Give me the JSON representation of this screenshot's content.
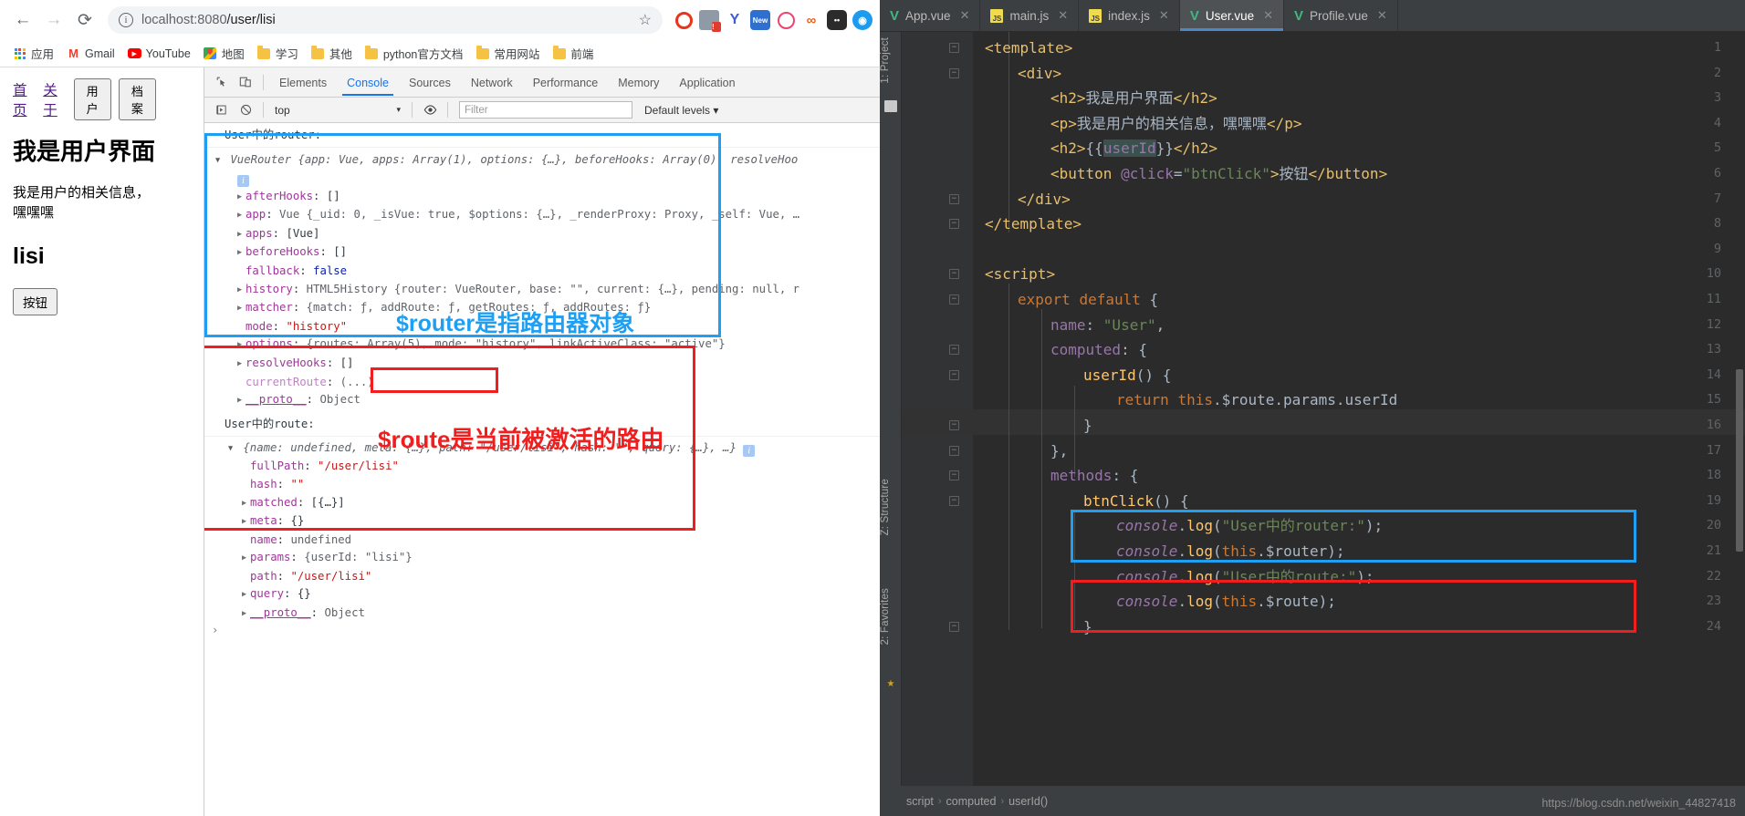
{
  "browser": {
    "nav": {
      "back": "←",
      "forward": "→",
      "reload": "⟳"
    },
    "omnibox": {
      "info_icon": "ⓘ",
      "url_host": "localhost:8080",
      "url_path": "/user/lisi",
      "url_full": "localhost:8080/user/lisi",
      "star_icon": "☆"
    },
    "extensions": [
      "ublock-origin-icon",
      "extension-warning-icon",
      "yandex-icon",
      "new-tab-icon",
      "clock-icon",
      "infinity-icon",
      "panda-icon",
      "location-icon"
    ],
    "bookmarks": [
      {
        "label": "应用",
        "icon": "apps-grid-icon"
      },
      {
        "label": "Gmail",
        "icon": "gmail-icon"
      },
      {
        "label": "YouTube",
        "icon": "youtube-icon"
      },
      {
        "label": "地图",
        "icon": "maps-icon"
      },
      {
        "label": "学习",
        "icon": "folder-icon"
      },
      {
        "label": "其他",
        "icon": "folder-icon"
      },
      {
        "label": "python官方文档",
        "icon": "folder-icon"
      },
      {
        "label": "常用网站",
        "icon": "folder-icon"
      },
      {
        "label": "前端",
        "icon": "folder-icon"
      }
    ]
  },
  "page": {
    "nav_links": [
      "首页",
      "关于"
    ],
    "nav_buttons": [
      "用户",
      "档案"
    ],
    "heading": "我是用户界面",
    "paragraph": "我是用户的相关信息，嘿嘿嘿",
    "user_id": "lisi",
    "button_label": "按钮"
  },
  "devtools": {
    "toolbar_icons": [
      "inspect-element-icon",
      "device-toolbar-icon"
    ],
    "tabs": [
      "Elements",
      "Console",
      "Sources",
      "Network",
      "Performance",
      "Memory",
      "Application"
    ],
    "active_tab": "Console",
    "filterbar": {
      "execute_icon": "execute-snippet-icon",
      "clear_icon": "clear-console-icon",
      "context": "top",
      "eye_icon": "live-expression-icon",
      "filter_placeholder": "Filter",
      "levels": "Default levels",
      "levels_caret": "▾"
    },
    "console": {
      "log1_label": "User中的router:",
      "router_header": "VueRouter {app: Vue, apps: Array(1), options: {…}, beforeHooks: Array(0), resolveHoo",
      "router_props": [
        {
          "key": "afterHooks",
          "value": "[]",
          "expandable": true
        },
        {
          "key": "app",
          "value": "Vue {_uid: 0, _isVue: true, $options: {…}, _renderProxy: Proxy, _self: Vue, …",
          "expandable": true
        },
        {
          "key": "apps",
          "value": "[Vue]",
          "expandable": true
        },
        {
          "key": "beforeHooks",
          "value": "[]",
          "expandable": true
        },
        {
          "key": "fallback",
          "value": "false",
          "expandable": false
        },
        {
          "key": "history",
          "value": "HTML5History {router: VueRouter, base: \"\", current: {…}, pending: null, r",
          "expandable": true
        },
        {
          "key": "matcher",
          "value": "{match: ƒ, addRoute: ƒ, getRoutes: ƒ, addRoutes: ƒ}",
          "expandable": true
        },
        {
          "key": "mode",
          "value": "\"history\"",
          "expandable": false
        },
        {
          "key": "options",
          "value": "{routes: Array(5), mode: \"history\", linkActiveClass: \"active\"}",
          "expandable": true
        },
        {
          "key": "resolveHooks",
          "value": "[]",
          "expandable": true
        },
        {
          "key": "currentRoute",
          "value": "(...)",
          "expandable": false
        },
        {
          "key": "__proto__",
          "value": "Object",
          "expandable": true
        }
      ],
      "log2_label": "User中的route:",
      "route_header": "{name: undefined, meta: {…}, path: \"/user/lisi\", hash: \"\", query: {…}, …}",
      "route_props": [
        {
          "key": "fullPath",
          "value": "\"/user/lisi\"",
          "expandable": false
        },
        {
          "key": "hash",
          "value": "\"\"",
          "expandable": false
        },
        {
          "key": "matched",
          "value": "[{…}]",
          "expandable": true
        },
        {
          "key": "meta",
          "value": "{}",
          "expandable": true
        },
        {
          "key": "name",
          "value": "undefined",
          "expandable": false
        },
        {
          "key": "params",
          "value": "{userId: \"lisi\"}",
          "expandable": true
        },
        {
          "key": "path",
          "value": "\"/user/lisi\"",
          "expandable": false
        },
        {
          "key": "query",
          "value": "{}",
          "expandable": true
        },
        {
          "key": "__proto__",
          "value": "Object",
          "expandable": true
        }
      ],
      "prompt": "›"
    },
    "annotations": {
      "router_note": "$router是指路由器对象",
      "route_note": "$route是当前被激活的路由",
      "router_note_color": "#1e9ff2",
      "route_note_color": "#f01e1e"
    }
  },
  "ide": {
    "tabs": [
      {
        "label": "App.vue",
        "icon": "vue-file-icon",
        "active": false
      },
      {
        "label": "main.js",
        "icon": "js-file-icon",
        "active": false
      },
      {
        "label": "index.js",
        "icon": "js-file-icon",
        "active": false
      },
      {
        "label": "User.vue",
        "icon": "vue-file-icon",
        "active": true
      },
      {
        "label": "Profile.vue",
        "icon": "vue-file-icon",
        "active": false
      }
    ],
    "rails": [
      "1: Project",
      "Z: Structure",
      "2: Favorites"
    ],
    "lines": [
      {
        "n": "1",
        "indent": 0,
        "text": "<template>"
      },
      {
        "n": "2",
        "indent": 1,
        "text": "<div>"
      },
      {
        "n": "3",
        "indent": 2,
        "text": "<h2>我是用户界面</h2>"
      },
      {
        "n": "4",
        "indent": 2,
        "text": "<p>我是用户的相关信息，嘿嘿嘿</p>"
      },
      {
        "n": "5",
        "indent": 2,
        "text": "<h2>{{userId}}</h2>"
      },
      {
        "n": "6",
        "indent": 2,
        "text": "<button @click=\"btnClick\">按钮</button>"
      },
      {
        "n": "7",
        "indent": 1,
        "text": "</div>"
      },
      {
        "n": "8",
        "indent": 0,
        "text": "</template>"
      },
      {
        "n": "9",
        "indent": 0,
        "text": ""
      },
      {
        "n": "10",
        "indent": 0,
        "text": "<script>"
      },
      {
        "n": "11",
        "indent": 1,
        "text": "export default {"
      },
      {
        "n": "12",
        "indent": 2,
        "text": "name: \"User\","
      },
      {
        "n": "13",
        "indent": 2,
        "text": "computed: {"
      },
      {
        "n": "14",
        "indent": 3,
        "text": "userId() {"
      },
      {
        "n": "15",
        "indent": 4,
        "text": "return this.$route.params.userId"
      },
      {
        "n": "16",
        "indent": 3,
        "text": "}"
      },
      {
        "n": "17",
        "indent": 2,
        "text": "},"
      },
      {
        "n": "18",
        "indent": 2,
        "text": "methods: {"
      },
      {
        "n": "19",
        "indent": 3,
        "text": "btnClick() {"
      },
      {
        "n": "20",
        "indent": 4,
        "text": "console.log(\"User中的router:\");"
      },
      {
        "n": "21",
        "indent": 4,
        "text": "console.log(this.$router);"
      },
      {
        "n": "22",
        "indent": 4,
        "text": "console.log(\"User中的route:\");"
      },
      {
        "n": "23",
        "indent": 4,
        "text": "console.log(this.$route);"
      },
      {
        "n": "24",
        "indent": 3,
        "text": "}"
      }
    ],
    "status_crumbs": [
      "script",
      "computed",
      "userId()"
    ],
    "watermark": "https://blog.csdn.net/weixin_44827418"
  }
}
